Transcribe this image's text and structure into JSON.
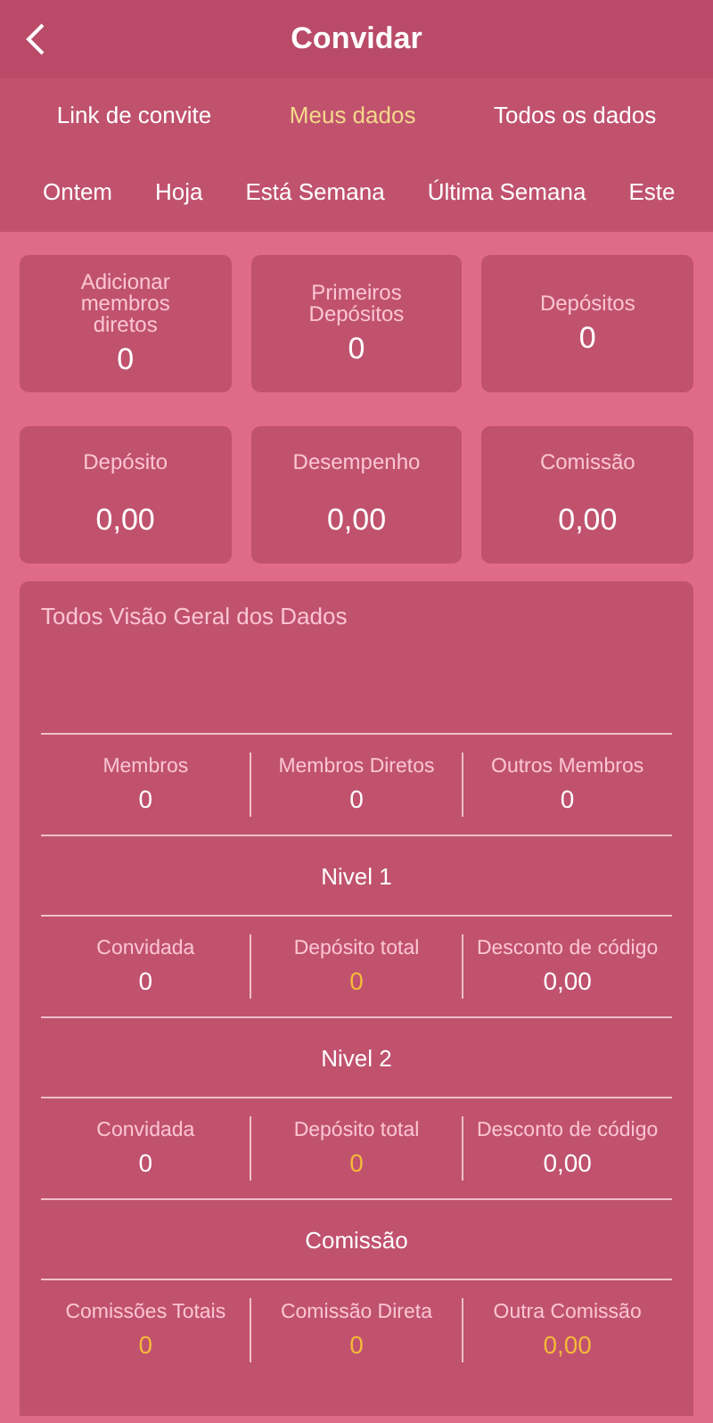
{
  "header": {
    "title": "Convidar"
  },
  "tabs": [
    {
      "label": "Link de convite",
      "selected": false
    },
    {
      "label": "Meus dados",
      "selected": true
    },
    {
      "label": "Todos os dados",
      "selected": false
    }
  ],
  "periods": [
    {
      "label": "Ontem",
      "selected": false
    },
    {
      "label": "Hoja",
      "selected": false
    },
    {
      "label": "Está Semana",
      "selected": false
    },
    {
      "label": "Última Semana",
      "selected": false
    },
    {
      "label": "Este",
      "selected": false
    }
  ],
  "stat_cards": [
    {
      "label": "Adicionar membros diretos",
      "value": "0"
    },
    {
      "label": "Primeiros Depósitos",
      "value": "0"
    },
    {
      "label": "Depósitos",
      "value": "0"
    },
    {
      "label": "Depósito",
      "value": "0,00"
    },
    {
      "label": "Desempenho",
      "value": "0,00"
    },
    {
      "label": "Comissão",
      "value": "0,00"
    }
  ],
  "overview": {
    "title": "Todos Visão Geral dos Dados",
    "sections": [
      {
        "stats": [
          {
            "label": "Membros",
            "value": "0",
            "highlighted": false
          },
          {
            "label": "Membros Diretos",
            "value": "0",
            "highlighted": false
          },
          {
            "label": "Outros Membros",
            "value": "0",
            "highlighted": false
          }
        ]
      },
      {
        "heading": "Nivel 1",
        "stats": [
          {
            "label": "Convidada",
            "value": "0",
            "highlighted": false
          },
          {
            "label": "Depósito total",
            "value": "0",
            "highlighted": true
          },
          {
            "label": "Desconto de código",
            "value": "0,00",
            "highlighted": false
          }
        ]
      },
      {
        "heading": "Nivel 2",
        "stats": [
          {
            "label": "Convidada",
            "value": "0",
            "highlighted": false
          },
          {
            "label": "Depósito total",
            "value": "0",
            "highlighted": true
          },
          {
            "label": "Desconto de código",
            "value": "0,00",
            "highlighted": false
          }
        ]
      },
      {
        "heading": "Comissão",
        "stats": [
          {
            "label": "Comissões Totais",
            "value": "0",
            "highlighted": true
          },
          {
            "label": "Comissão Direta",
            "value": "0",
            "highlighted": true
          },
          {
            "label": "Outra Comissão",
            "value": "0,00",
            "highlighted": true
          }
        ]
      }
    ]
  }
}
